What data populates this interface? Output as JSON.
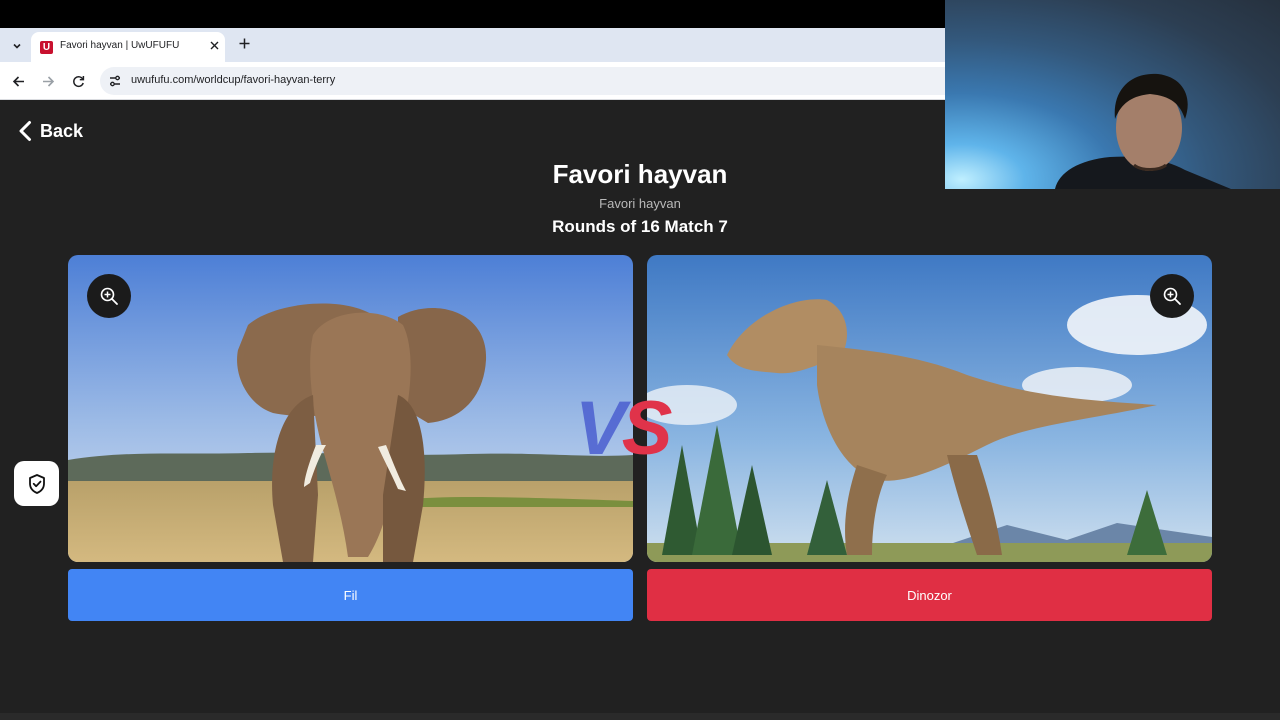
{
  "browser": {
    "tab_title": "Favori hayvan | UwUFUFU",
    "favicon_letter": "U",
    "url": "uwufufu.com/worldcup/favori-hayvan-terry"
  },
  "page": {
    "back_label": "Back",
    "title": "Favori hayvan",
    "subtitle": "Favori hayvan",
    "round": "Rounds of 16 Match 7",
    "vs_v": "V",
    "vs_s": "S"
  },
  "left": {
    "label": "Fil",
    "image": "elephant-photo",
    "button_color": "#4285f4"
  },
  "right": {
    "label": "Dinozor",
    "image": "tyrannosaurus-illustration",
    "button_color": "#e02f44"
  },
  "icons": {
    "zoom": "zoom-in-icon",
    "shield": "shield-check-icon",
    "back": "chevron-left-icon"
  }
}
